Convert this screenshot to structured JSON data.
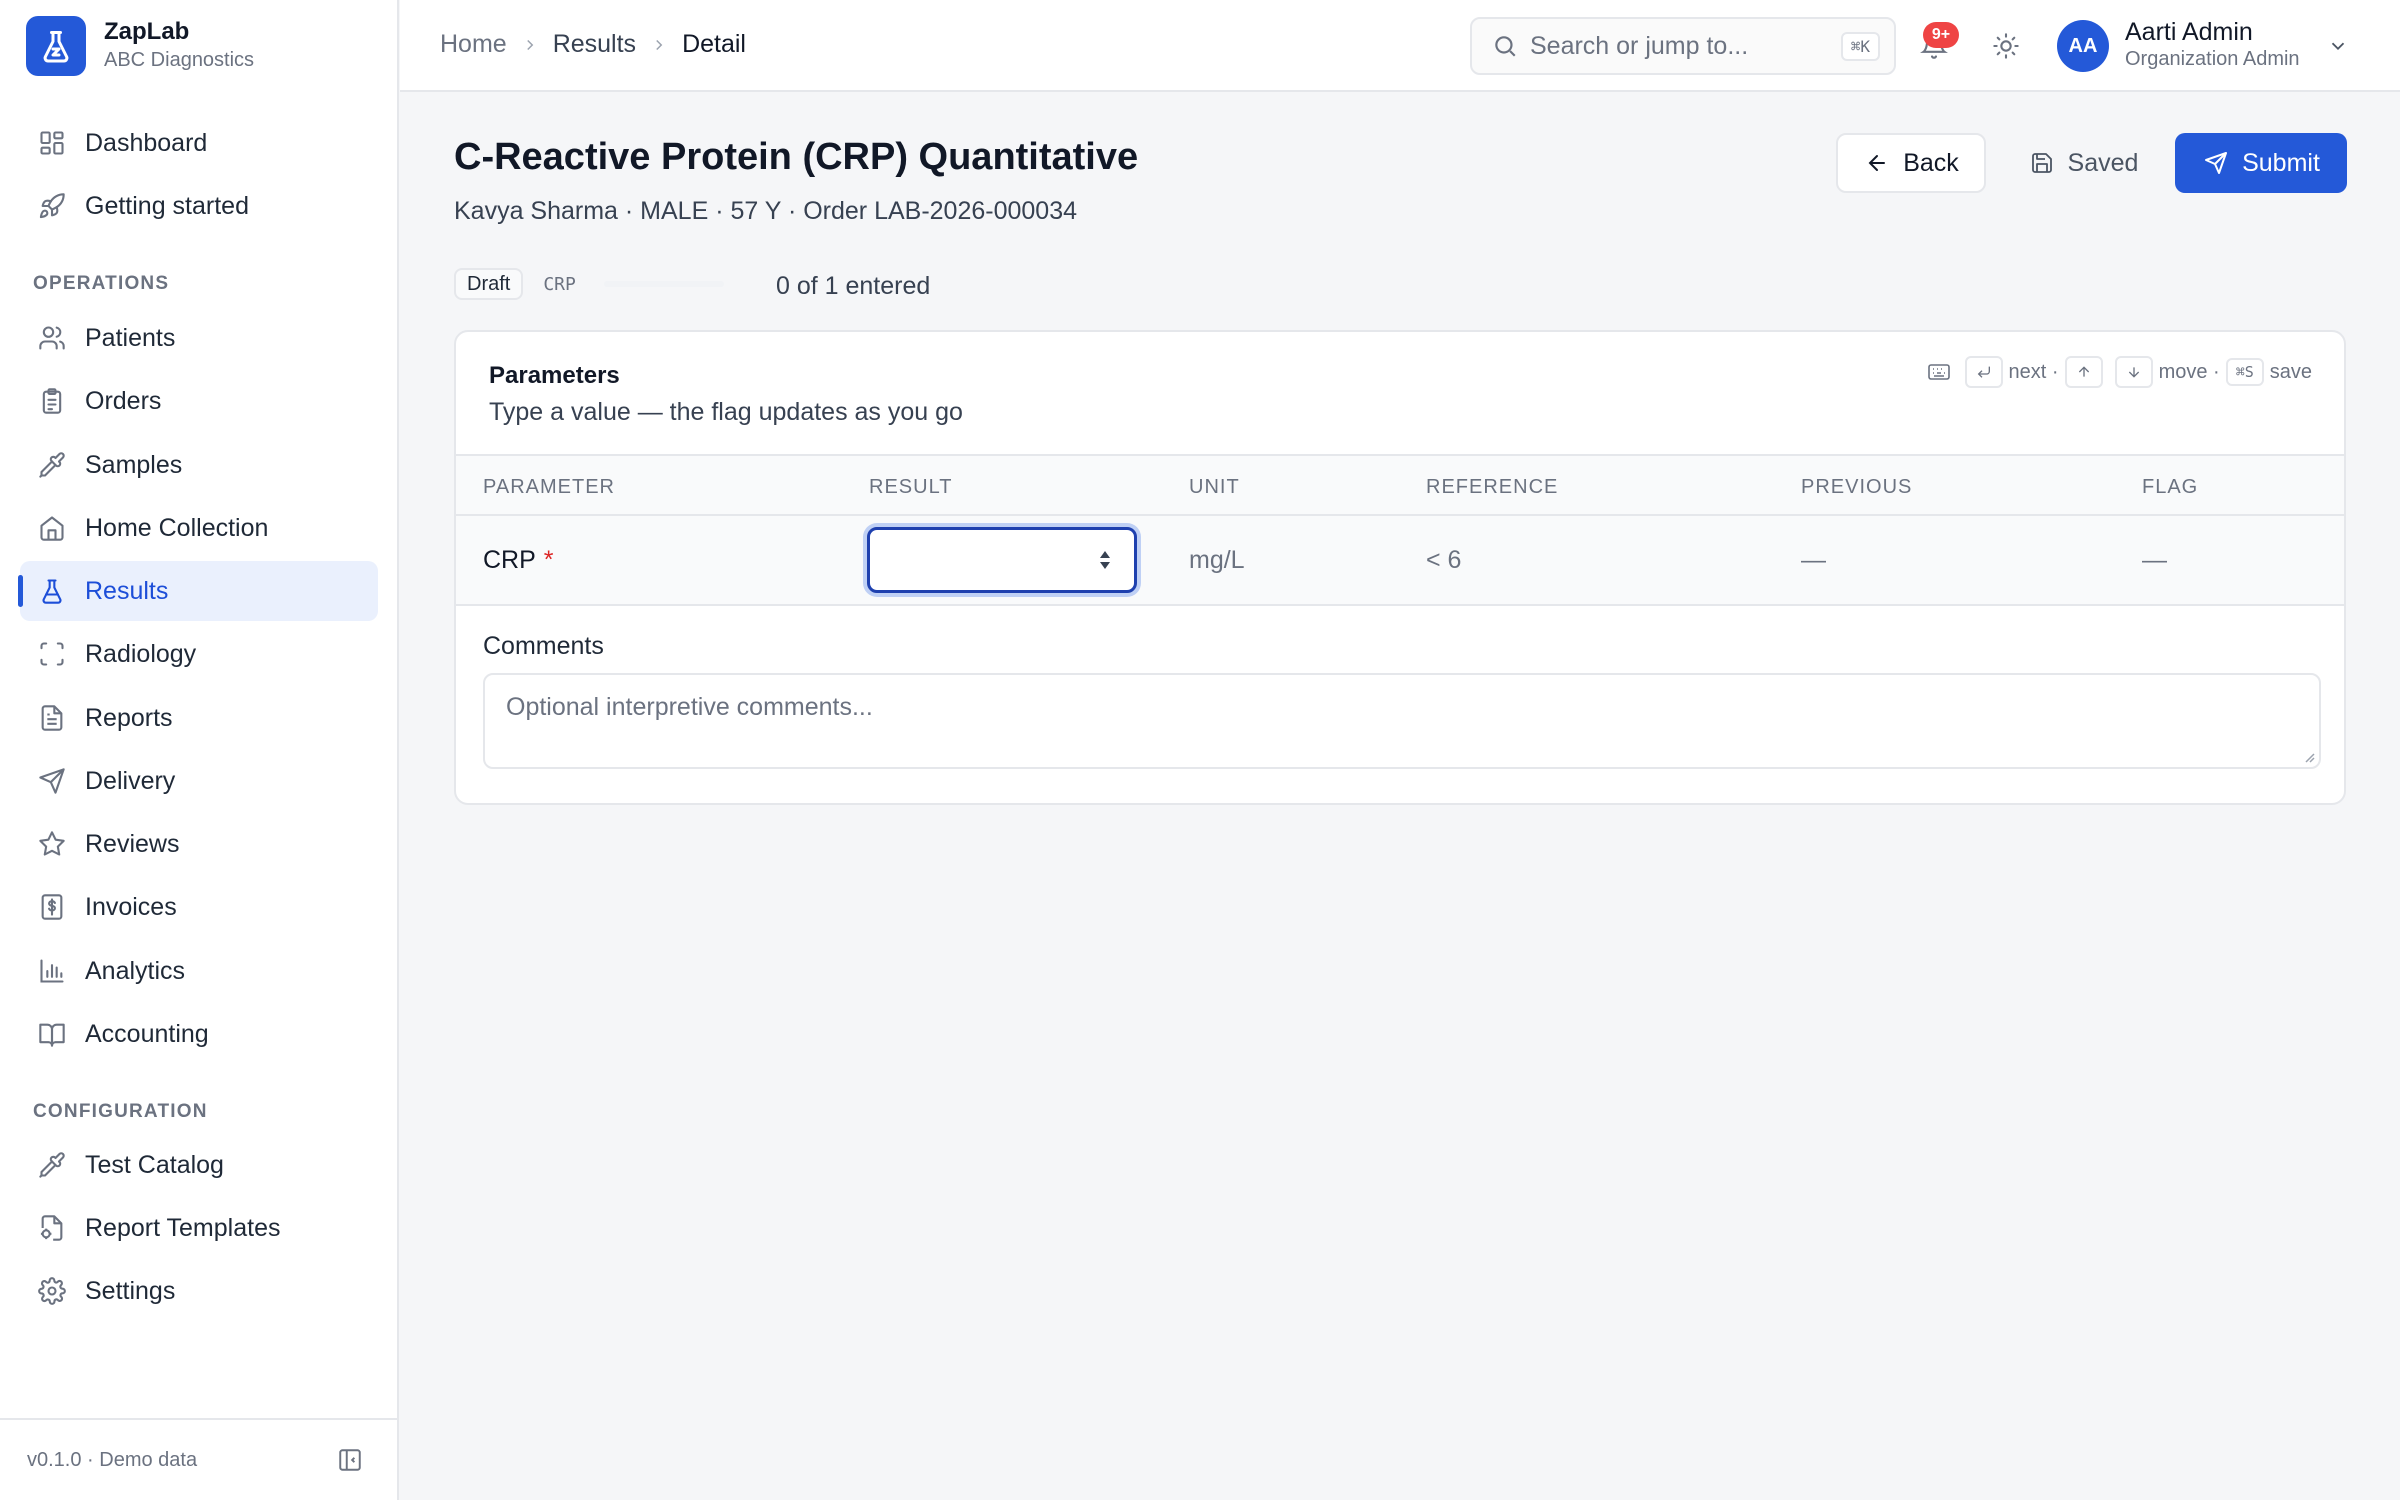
{
  "brand": {
    "name": "ZapLab",
    "org": "ABC Diagnostics",
    "logo_icon": "flask-icon",
    "accent": "#2459d8"
  },
  "sidebar": {
    "top_items": [
      {
        "label": "Dashboard",
        "icon": "grid-icon"
      },
      {
        "label": "Getting started",
        "icon": "rocket-icon"
      }
    ],
    "sections": [
      {
        "title": "OPERATIONS",
        "items": [
          {
            "label": "Patients",
            "icon": "users-icon"
          },
          {
            "label": "Orders",
            "icon": "clipboard-icon"
          },
          {
            "label": "Samples",
            "icon": "pipette-icon"
          },
          {
            "label": "Home Collection",
            "icon": "home-icon"
          },
          {
            "label": "Results",
            "icon": "flask-icon",
            "active": true
          },
          {
            "label": "Radiology",
            "icon": "scan-icon"
          },
          {
            "label": "Reports",
            "icon": "file-text-icon"
          },
          {
            "label": "Delivery",
            "icon": "send-icon"
          },
          {
            "label": "Reviews",
            "icon": "star-icon"
          },
          {
            "label": "Invoices",
            "icon": "receipt-icon"
          },
          {
            "label": "Analytics",
            "icon": "bar-chart-icon"
          },
          {
            "label": "Accounting",
            "icon": "book-icon"
          }
        ]
      },
      {
        "title": "CONFIGURATION",
        "items": [
          {
            "label": "Test Catalog",
            "icon": "pipette-icon"
          },
          {
            "label": "Report Templates",
            "icon": "file-settings-icon"
          },
          {
            "label": "Settings",
            "icon": "gear-icon"
          }
        ]
      }
    ],
    "footer": {
      "version": "v0.1.0 · Demo data",
      "collapse_icon": "panel-left-icon"
    }
  },
  "topbar": {
    "breadcrumbs": [
      "Home",
      "Results",
      "Detail"
    ],
    "search": {
      "placeholder": "Search or jump to...",
      "shortcut": "⌘K"
    },
    "notifications": {
      "badge": "9+"
    },
    "user": {
      "initials": "AA",
      "name": "Aarti Admin",
      "role": "Organization Admin"
    }
  },
  "page": {
    "title": "C-Reactive Protein (CRP) Quantitative",
    "subtitle": "Kavya Sharma · MALE · 57 Y · Order LAB-2026-000034",
    "buttons": {
      "back": "Back",
      "saved": "Saved",
      "submit": "Submit"
    },
    "status": {
      "chip": "Draft",
      "code": "CRP",
      "progress": 0,
      "entered": "0 of 1 entered"
    }
  },
  "parameters": {
    "title": "Parameters",
    "subtitle": "Type a value — the flag updates as you go",
    "hints": {
      "next": "next ·",
      "move": "move ·",
      "save_key": "⌘S",
      "save": "save"
    },
    "columns": [
      "PARAMETER",
      "RESULT",
      "UNIT",
      "REFERENCE",
      "PREVIOUS",
      "FLAG"
    ],
    "rows": [
      {
        "parameter": "CRP",
        "required_mark": "*",
        "result": "",
        "unit": "mg/L",
        "reference": "< 6",
        "previous": "—",
        "flag": "—"
      }
    ],
    "comments": {
      "label": "Comments",
      "placeholder": "Optional interpretive comments..."
    }
  }
}
